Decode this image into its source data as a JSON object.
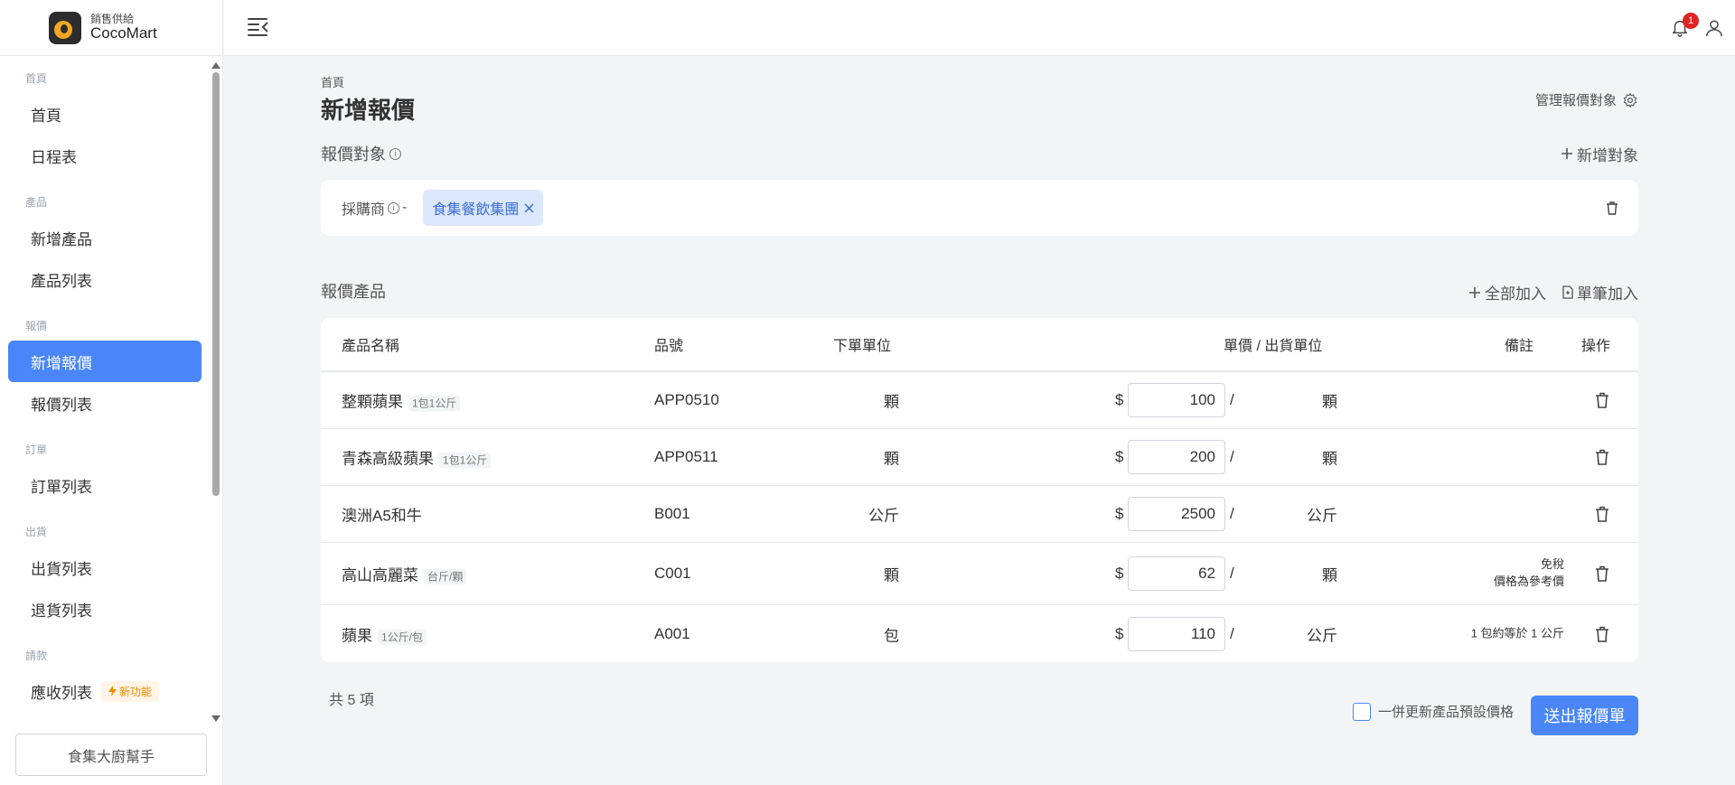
{
  "brand": {
    "subtitle": "銷售供給",
    "name": "CocoMart"
  },
  "sidebar": {
    "groups": [
      {
        "title": "首頁",
        "items": [
          {
            "label": "首頁"
          },
          {
            "label": "日程表"
          }
        ]
      },
      {
        "title": "產品",
        "items": [
          {
            "label": "新增產品"
          },
          {
            "label": "產品列表"
          }
        ]
      },
      {
        "title": "報價",
        "items": [
          {
            "label": "新增報價"
          },
          {
            "label": "報價列表"
          }
        ]
      },
      {
        "title": "訂單",
        "items": [
          {
            "label": "訂單列表"
          }
        ]
      },
      {
        "title": "出貨",
        "items": [
          {
            "label": "出貨列表"
          },
          {
            "label": "退貨列表"
          }
        ]
      },
      {
        "title": "請款",
        "items": [
          {
            "label": "應收列表",
            "badge": "新功能"
          }
        ]
      }
    ],
    "active": "新增報價",
    "helper_button": "食集大廚幫手"
  },
  "topbar": {
    "notification_count": "1"
  },
  "main": {
    "breadcrumb": "首頁",
    "title": "新增報價",
    "manage_link": "管理報價對象",
    "target_section": {
      "title": "報價對象",
      "add_button": "新增對象",
      "label": "採購商",
      "separator": " -",
      "tag": "食集餐飲集團"
    },
    "products_section": {
      "title": "報價產品",
      "add_all": "全部加入",
      "add_single": "單筆加入",
      "columns": {
        "name": "產品名稱",
        "sku": "品號",
        "order_unit": "下單單位",
        "price_unit": "單價 / 出貨單位",
        "note": "備註",
        "action": "操作"
      },
      "rows": [
        {
          "name": "整顆蘋果",
          "hint": "1包1公斤",
          "sku": "APP0510",
          "order_unit": "顆",
          "currency": "$",
          "price": "100",
          "slash": "/",
          "ship_unit": "顆",
          "note1": "",
          "note2": ""
        },
        {
          "name": "青森高級蘋果",
          "hint": "1包1公斤",
          "sku": "APP0511",
          "order_unit": "顆",
          "currency": "$",
          "price": "200",
          "slash": "/",
          "ship_unit": "顆",
          "note1": "",
          "note2": ""
        },
        {
          "name": "澳洲A5和牛",
          "hint": "",
          "sku": "B001",
          "order_unit": "公斤",
          "currency": "$",
          "price": "2500",
          "slash": "/",
          "ship_unit": "公斤",
          "note1": "",
          "note2": ""
        },
        {
          "name": "高山高麗菜",
          "hint": "台斤/顆",
          "sku": "C001",
          "order_unit": "顆",
          "currency": "$",
          "price": "62",
          "slash": "/",
          "ship_unit": "顆",
          "note1": "免稅",
          "note2": "價格為參考價"
        },
        {
          "name": "蘋果",
          "hint": "1公斤/包",
          "sku": "A001",
          "order_unit": "包",
          "currency": "$",
          "price": "110",
          "slash": "/",
          "ship_unit": "公斤",
          "note1": "1 包約等於 1 公斤",
          "note2": ""
        }
      ],
      "total": "共 5 項",
      "sync_checkbox_label": "一併更新產品預設價格",
      "submit": "送出報價單"
    }
  },
  "colors": {
    "accent": "#4a86f7",
    "tag_bg": "#dbe7fd",
    "badge_orange": "#f08c00",
    "notif_red": "#e02424"
  },
  "icons": [
    "menu-collapse-icon",
    "bell-icon",
    "user-icon",
    "gear-icon",
    "info-icon",
    "plus-icon",
    "trash-icon",
    "document-icon",
    "close-icon",
    "lightning-icon"
  ]
}
